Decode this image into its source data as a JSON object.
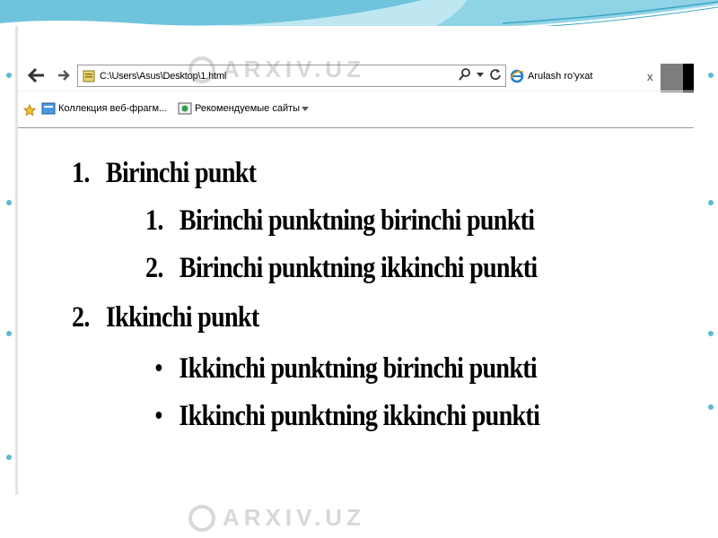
{
  "browser": {
    "address": "C:\\Users\\Asus\\Desktop\\1.html",
    "tab_title": "Arulash ro'yxat",
    "tab_close": "x"
  },
  "favorites": {
    "items": [
      {
        "label": "Коллекция веб-фрагм..."
      },
      {
        "label": "Рекомендуемые сайты"
      }
    ]
  },
  "page": {
    "items": [
      {
        "marker": "1.",
        "text": "Birinchi punkt"
      },
      {
        "marker": "1.",
        "text": "Birinchi punktning birinchi punkti"
      },
      {
        "marker": "2.",
        "text": "Birinchi punktning ikkinchi punkti"
      },
      {
        "marker": "2.",
        "text": "Ikkinchi punkt"
      },
      {
        "marker": "•",
        "text": "Ikkinchi punktning birinchi punkti"
      },
      {
        "marker": "•",
        "text": "Ikkinchi punktning ikkinchi punkti"
      }
    ]
  },
  "watermark": {
    "text": "ARXIV.UZ"
  },
  "colors": {
    "accent": "#3da7c4",
    "watermark": "#777777"
  }
}
